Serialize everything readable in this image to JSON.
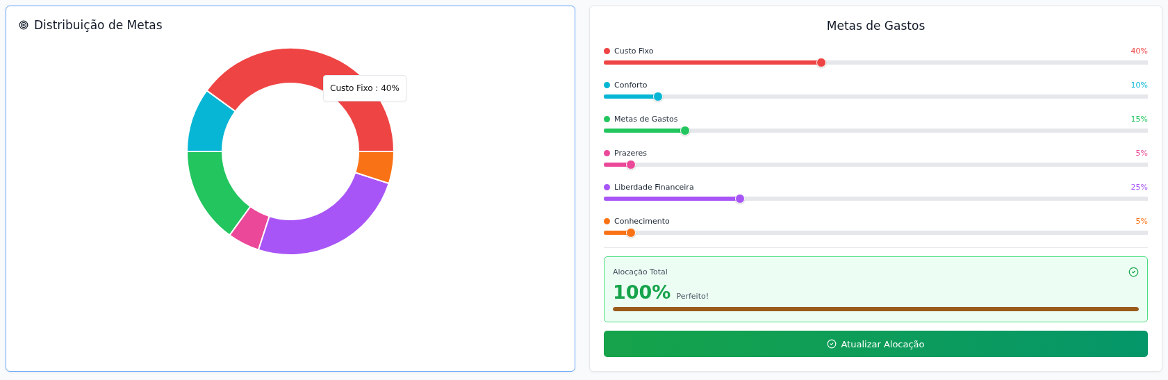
{
  "distribution": {
    "title": "Distribuição de Metas",
    "tooltip": "Custo Fixo : 40%"
  },
  "goals": {
    "title": "Metas de Gastos",
    "items": [
      {
        "name": "Custo Fixo",
        "color": "#ef4444",
        "level": 0.4,
        "reading": "40%"
      },
      {
        "name": "Conforto",
        "color": "#06b6d4",
        "level": 0.1,
        "reading": "10%"
      },
      {
        "name": "Metas de Gastos",
        "color": "#22c55e",
        "level": 0.15,
        "reading": "15%"
      },
      {
        "name": "Prazeres",
        "color": "#ec4899",
        "level": 0.05,
        "reading": "5%"
      },
      {
        "name": "Liberdade Financeira",
        "color": "#a855f7",
        "level": 0.25,
        "reading": "25%"
      },
      {
        "name": "Conhecimento",
        "color": "#f97316",
        "level": 0.05,
        "reading": "5%"
      }
    ],
    "total": {
      "label": "Alocação Total",
      "value": "100%",
      "status": "Perfeito!",
      "level": 1
    },
    "button": "Atualizar Alocação"
  }
}
